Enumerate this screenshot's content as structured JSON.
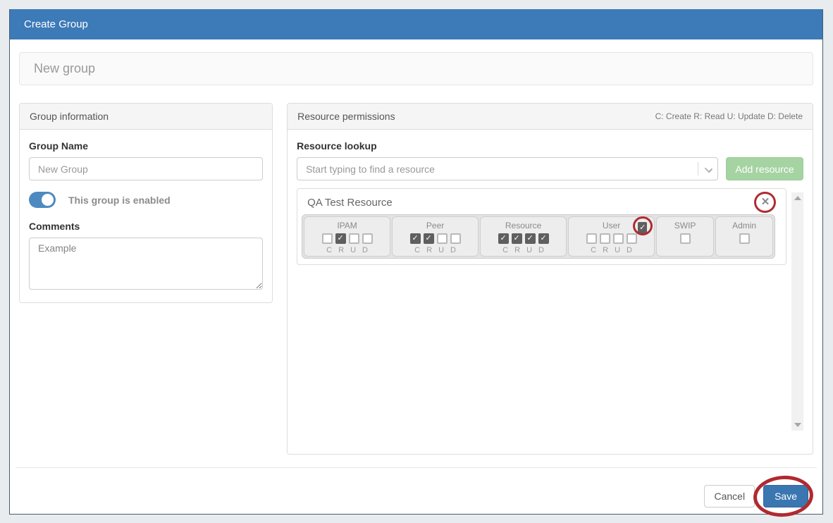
{
  "window": {
    "title": "Create Group"
  },
  "subtitle": "New group",
  "group_info": {
    "header": "Group information",
    "name_label": "Group Name",
    "name_value": "New Group",
    "enabled_label": "This group is enabled",
    "enabled": true,
    "comments_label": "Comments",
    "comments_value": "Example"
  },
  "resource_permissions": {
    "header": "Resource permissions",
    "legend": "C: Create R: Read U: Update D: Delete",
    "lookup_label": "Resource lookup",
    "lookup_placeholder": "Start typing to find a resource",
    "add_button_label": "Add resource",
    "crud_letters": [
      "C",
      "R",
      "U",
      "D"
    ],
    "resources": [
      {
        "name": "QA Test Resource",
        "close_annotated": true,
        "modules": [
          {
            "name": "IPAM",
            "type": "crud",
            "checked": [
              false,
              true,
              false,
              false
            ]
          },
          {
            "name": "Peer",
            "type": "crud",
            "checked": [
              true,
              true,
              false,
              false
            ]
          },
          {
            "name": "Resource",
            "type": "crud",
            "checked": [
              true,
              true,
              true,
              true
            ]
          },
          {
            "name": "User",
            "type": "crud",
            "checked": [
              false,
              false,
              false,
              false
            ],
            "header_checkbox_checked": true,
            "header_checkbox_annotated": true
          },
          {
            "name": "SWIP",
            "type": "single",
            "checked": [
              false
            ]
          },
          {
            "name": "Admin",
            "type": "single",
            "checked": [
              false
            ]
          }
        ]
      }
    ]
  },
  "footer": {
    "cancel_label": "Cancel",
    "save_label": "Save",
    "save_annotated": true
  },
  "colors": {
    "header_bg": "#3d7ab8",
    "save_blue": "#3a76b0",
    "toggle_blue": "#4d8ac0",
    "add_green": "#a5d3a2",
    "checked_box_gray": "#5f5f5f",
    "annotation_red": "#b02a30"
  }
}
